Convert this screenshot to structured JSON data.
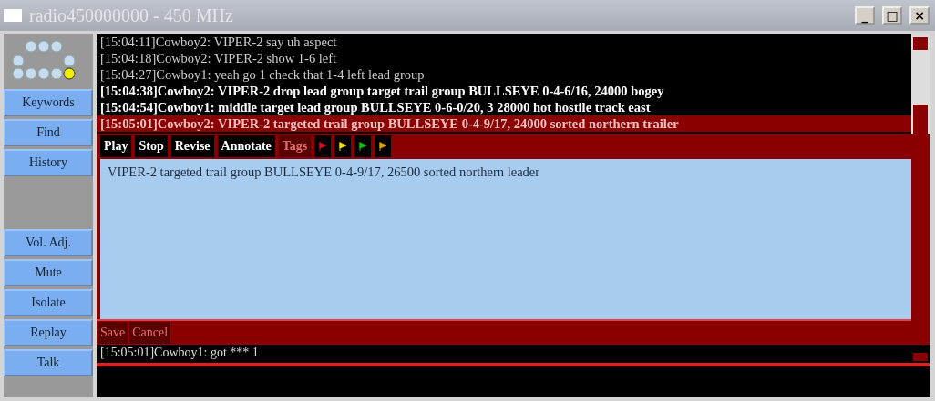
{
  "window": {
    "title": "radio450000000 - 450 MHz",
    "controls": [
      "_",
      "□",
      "×"
    ]
  },
  "sidebar": {
    "lights": [
      {
        "on": false
      },
      {
        "on": false
      },
      {
        "on": false
      },
      {
        "on": false
      },
      {
        "on": false
      },
      {
        "on": false
      },
      {
        "on": false
      },
      {
        "on": false
      },
      {
        "on": false
      },
      {
        "on": true
      }
    ],
    "top_buttons": [
      "Keywords",
      "Find",
      "History"
    ],
    "bottom_buttons": [
      "Vol. Adj.",
      "Mute",
      "Isolate",
      "Replay",
      "Talk"
    ]
  },
  "messages": [
    {
      "time": "[15:04:11]",
      "speaker": "Cowboy2:",
      "text": "VIPER-2 say uh aspect",
      "bold": false,
      "selected": false
    },
    {
      "time": "[15:04:18]",
      "speaker": "Cowboy2:",
      "text": "VIPER-2 show 1-6 left",
      "bold": false,
      "selected": false
    },
    {
      "time": "[15:04:27]",
      "speaker": "Cowboy1:",
      "text": "yeah go 1 check that 1-4 left lead group",
      "bold": false,
      "selected": false
    },
    {
      "time": "[15:04:38]",
      "speaker": "Cowboy2:",
      "text": "VIPER-2 drop lead group target trail group BULLSEYE 0-4-6/16, 24000 bogey",
      "bold": true,
      "selected": false
    },
    {
      "time": "[15:04:54]",
      "speaker": "Cowboy1:",
      "text": "middle target lead group BULLSEYE 0-6-0/20, 3 28000 hot hostile track east",
      "bold": true,
      "selected": false
    },
    {
      "time": "[15:05:01]",
      "speaker": "Cowboy2:",
      "text": "VIPER-2 targeted trail group BULLSEYE 0-4-9/17, 24000 sorted northern trailer",
      "bold": true,
      "selected": true
    }
  ],
  "toolbar": {
    "buttons": [
      {
        "label": "Play",
        "disabled": false
      },
      {
        "label": "Stop",
        "disabled": false
      },
      {
        "label": "Revise",
        "disabled": false
      },
      {
        "label": "Annotate",
        "disabled": false
      },
      {
        "label": "Tags",
        "disabled": true
      }
    ],
    "tag_flags": [
      {
        "color": "#d01020"
      },
      {
        "color": "#e8e000"
      },
      {
        "color": "#10c010"
      },
      {
        "color": "#d8a000"
      }
    ]
  },
  "revision": {
    "value": "VIPER-2 targeted trail group BULLSEYE 0-4-9/17, 26500 sorted northern leader"
  },
  "revision_buttons": [
    {
      "label": "Save",
      "disabled": true
    },
    {
      "label": "Cancel",
      "disabled": true
    }
  ],
  "partial_message": "[15:05:01]Cowboy1: got *** 1"
}
